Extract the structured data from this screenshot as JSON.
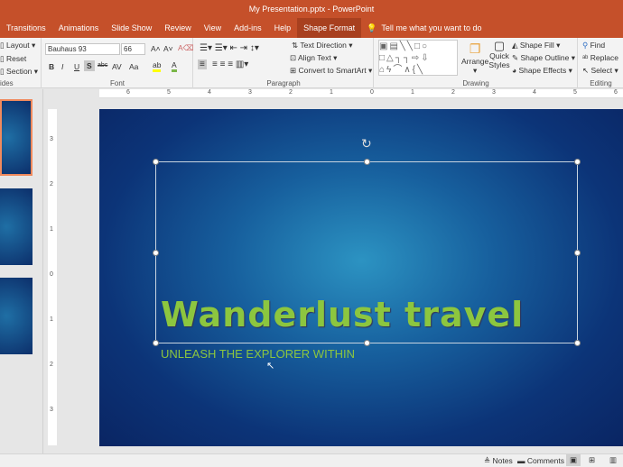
{
  "window": {
    "title": "My Presentation.pptx  -  PowerPoint"
  },
  "tabs": [
    {
      "label": "Transitions"
    },
    {
      "label": "Animations"
    },
    {
      "label": "Slide Show"
    },
    {
      "label": "Review"
    },
    {
      "label": "View"
    },
    {
      "label": "Add-ins"
    },
    {
      "label": "Help"
    },
    {
      "label": "Shape Format",
      "active": true
    }
  ],
  "tell_me": "Tell me what you want to do",
  "ribbon": {
    "slides": {
      "layout": "Layout",
      "reset": "Reset",
      "section": "Section",
      "label": "ides"
    },
    "font": {
      "name": "Bauhaus 93",
      "size": "66",
      "label": "Font",
      "bold": "B",
      "italic": "I",
      "underline": "U",
      "shadow": "S",
      "strike": "abc",
      "spacing": "AV",
      "case": "Aa",
      "color": "A"
    },
    "paragraph": {
      "text_direction": "Text Direction",
      "align_text": "Align Text",
      "smartart": "Convert to SmartArt",
      "label": "Paragraph"
    },
    "drawing": {
      "arrange": "Arrange",
      "quick_styles": "Quick Styles",
      "shape_fill": "Shape Fill",
      "shape_outline": "Shape Outline",
      "shape_effects": "Shape Effects",
      "label": "Drawing"
    },
    "editing": {
      "find": "Find",
      "replace": "Replace",
      "select": "Select",
      "label": "Editing"
    }
  },
  "ruler": {
    "h": [
      "6",
      "5",
      "4",
      "3",
      "2",
      "1",
      "0",
      "1",
      "2",
      "3",
      "4",
      "5",
      "6"
    ],
    "v": [
      "3",
      "2",
      "1",
      "0",
      "1",
      "2",
      "3"
    ]
  },
  "slide": {
    "title": "Wanderlust travel",
    "subtitle": "UNLEASH THE EXPLORER WITHIN"
  },
  "status": {
    "notes": "Notes",
    "comments": "Comments"
  },
  "colors": {
    "accent": "#c5502a",
    "title_text": "#8cc63f"
  }
}
